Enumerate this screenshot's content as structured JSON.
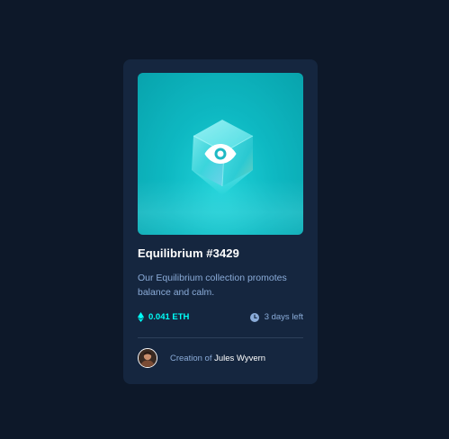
{
  "card": {
    "title": "Equilibrium #3429",
    "description": "Our Equilibrium collection promotes balance and calm.",
    "price": "0.041 ETH",
    "time_left": "3 days left",
    "creator_prefix": "Creation of ",
    "creator_name": "Jules Wyvern"
  },
  "colors": {
    "page_background": "#0d1829",
    "card_background": "#15263f",
    "accent_cyan": "#00fff8",
    "soft_blue": "#8bacd9",
    "divider": "#2e405a",
    "white": "#ffffff"
  },
  "icons": {
    "price": "ethereum-icon",
    "time": "clock-icon",
    "hero_overlay": "eye-icon"
  }
}
